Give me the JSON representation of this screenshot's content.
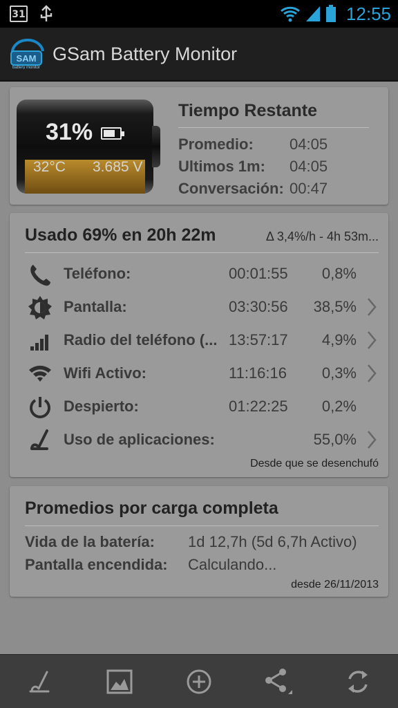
{
  "status": {
    "calendar_day": "31",
    "time": "12:55"
  },
  "app": {
    "logo_text": "SAM",
    "logo_sub": "battery monitor",
    "title": "GSam Battery Monitor"
  },
  "battery": {
    "percent": "31%",
    "level": 0.31,
    "temperature": "32°C",
    "voltage": "3.685 V"
  },
  "remaining": {
    "title": "Tiempo Restante",
    "rows": [
      {
        "label": "Promedio:",
        "value": "04:05"
      },
      {
        "label": "Ultimos 1m:",
        "value": "04:05"
      },
      {
        "label": "Conversación:",
        "value": "00:47"
      }
    ]
  },
  "usage": {
    "title": "Usado 69% en 20h 22m",
    "delta": "Δ 3,4%/h - 4h 53m...",
    "rows": [
      {
        "icon": "phone-icon",
        "label": "Teléfono:",
        "time": "00:01:55",
        "pct": "0,8%",
        "chevron": false
      },
      {
        "icon": "screen-brightness-icon",
        "label": "Pantalla:",
        "time": "03:30:56",
        "pct": "38,5%",
        "chevron": true
      },
      {
        "icon": "signal-bars-icon",
        "label": "Radio del teléfono (...",
        "time": "13:57:17",
        "pct": "4,9%",
        "chevron": true
      },
      {
        "icon": "wifi-icon",
        "label": "Wifi Activo:",
        "time": "11:16:16",
        "pct": "0,3%",
        "chevron": true
      },
      {
        "icon": "power-icon",
        "label": "Despierto:",
        "time": "01:22:25",
        "pct": "0,2%",
        "chevron": false
      },
      {
        "icon": "app-usage-icon",
        "label": "Uso de aplicaciones:",
        "time": "",
        "pct": "55,0%",
        "chevron": true
      }
    ],
    "since": "Desde que se desenchufó"
  },
  "averages": {
    "title": "Promedios por carga completa",
    "rows": [
      {
        "label": "Vida de la batería:",
        "value": "1d 12,7h (5d 6,7h Activo)"
      },
      {
        "label": "Pantalla encendida:",
        "value": "Calculando..."
      }
    ],
    "since": "desde 26/11/2013"
  },
  "bottom_bar": {
    "buttons": [
      "app-usage-icon",
      "image-icon",
      "add-icon",
      "share-icon",
      "refresh-icon"
    ]
  }
}
